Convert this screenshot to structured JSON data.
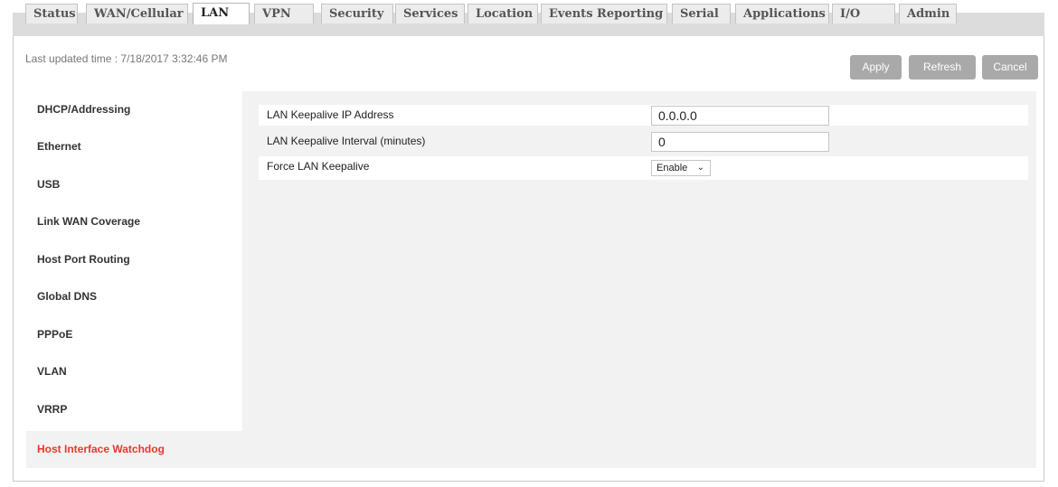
{
  "tabs": [
    {
      "label": "Status"
    },
    {
      "label": "WAN/Cellular"
    },
    {
      "label": "LAN"
    },
    {
      "label": "VPN"
    },
    {
      "label": "Security"
    },
    {
      "label": "Services"
    },
    {
      "label": "Location"
    },
    {
      "label": "Events Reporting"
    },
    {
      "label": "Serial"
    },
    {
      "label": "Applications"
    },
    {
      "label": "I/O"
    },
    {
      "label": "Admin"
    }
  ],
  "active_tab": "LAN",
  "last_updated": "Last updated time : 7/18/2017 3:32:46 PM",
  "toolbar": {
    "apply": "Apply",
    "refresh": "Refresh",
    "cancel": "Cancel"
  },
  "sidebar": {
    "items": [
      {
        "label": "DHCP/Addressing"
      },
      {
        "label": "Ethernet"
      },
      {
        "label": "USB"
      },
      {
        "label": "Link WAN Coverage"
      },
      {
        "label": "Host Port Routing"
      },
      {
        "label": "Global DNS"
      },
      {
        "label": "PPPoE"
      },
      {
        "label": "VLAN"
      },
      {
        "label": "VRRP"
      },
      {
        "label": "Host Interface Watchdog"
      }
    ],
    "active": "Host Interface Watchdog"
  },
  "form": {
    "keepalive_ip": {
      "label": "LAN Keepalive IP Address",
      "value": "0.0.0.0"
    },
    "keepalive_interval": {
      "label": "LAN Keepalive Interval (minutes)",
      "value": "0"
    },
    "force_keepalive": {
      "label": "Force LAN Keepalive",
      "value": "Enable"
    }
  },
  "colors": {
    "active_sidebar": "#e23a2e",
    "button_disabled": "#a9a9a9",
    "panel_bg": "#f2f2f2"
  }
}
